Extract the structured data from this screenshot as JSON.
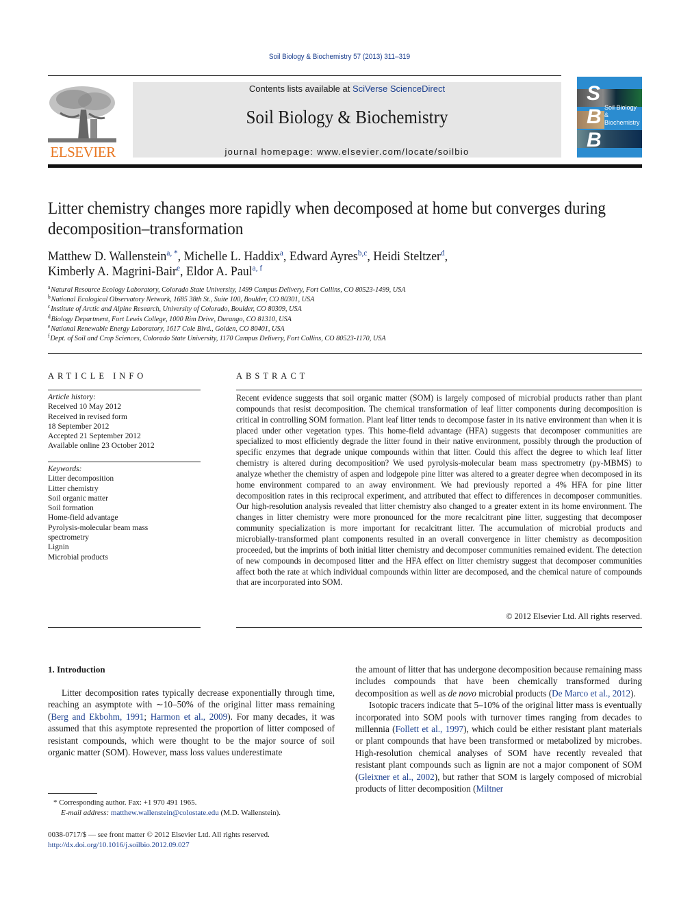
{
  "header": {
    "citation": "Soil Biology & Biochemistry 57 (2013) 311–319",
    "contents_prefix": "Contents lists available at ",
    "contents_link": "SciVerse ScienceDirect",
    "journal_title": "Soil Biology & Biochemistry",
    "homepage": "journal homepage: www.elsevier.com/locate/soilbio",
    "publisher_logo_text": "ELSEVIER",
    "cover": {
      "letters": [
        "S",
        "B",
        "B"
      ],
      "subtitle_line1": "Soil Biology &",
      "subtitle_line2": "Biochemistry"
    },
    "colors": {
      "publisher_orange": "#e87722",
      "cover_blue": "#2b8cd0",
      "link_blue": "#1b3f8f",
      "masthead_gray": "#e6e6e6"
    }
  },
  "article": {
    "title": "Litter chemistry changes more rapidly when decomposed at home but converges during decomposition–transformation",
    "authors": [
      {
        "name": "Matthew D. Wallenstein",
        "affil": "a, *",
        "sep": ", "
      },
      {
        "name": "Michelle L. Haddix",
        "affil": "a",
        "sep": ", "
      },
      {
        "name": "Edward Ayres",
        "affil": "b,c",
        "sep": ", "
      },
      {
        "name": "Heidi Steltzer",
        "affil": "d",
        "sep": ","
      },
      {
        "name": "Kimberly A. Magrini-Bair",
        "affil": "e",
        "sep": ", "
      },
      {
        "name": "Eldor A. Paul",
        "affil": "a, f",
        "sep": ""
      }
    ],
    "affiliations": [
      {
        "key": "a",
        "text": "Natural Resource Ecology Laboratory, Colorado State University, 1499 Campus Delivery, Fort Collins, CO 80523-1499, USA"
      },
      {
        "key": "b",
        "text": "National Ecological Observatory Network, 1685 38th St., Suite 100, Boulder, CO 80301, USA"
      },
      {
        "key": "c",
        "text": "Institute of Arctic and Alpine Research, University of Colorado, Boulder, CO 80309, USA"
      },
      {
        "key": "d",
        "text": "Biology Department, Fort Lewis College, 1000 Rim Drive, Durango, CO 81310, USA"
      },
      {
        "key": "e",
        "text": "National Renewable Energy Laboratory, 1617 Cole Blvd., Golden, CO 80401, USA"
      },
      {
        "key": "f",
        "text": "Dept. of Soil and Crop Sciences, Colorado State University, 1170 Campus Delivery, Fort Collins, CO 80523-1170, USA"
      }
    ]
  },
  "article_info": {
    "heading": "ARTICLE INFO",
    "history_label": "Article history:",
    "history": [
      "Received 10 May 2012",
      "Received in revised form",
      "18 September 2012",
      "Accepted 21 September 2012",
      "Available online 23 October 2012"
    ],
    "keywords_label": "Keywords:",
    "keywords": [
      "Litter decomposition",
      "Litter chemistry",
      "Soil organic matter",
      "Soil formation",
      "Home-field advantage",
      "Pyrolysis-molecular beam mass",
      "spectrometry",
      "Lignin",
      "Microbial products"
    ]
  },
  "abstract": {
    "heading": "ABSTRACT",
    "text": "Recent evidence suggests that soil organic matter (SOM) is largely composed of microbial products rather than plant compounds that resist decomposition. The chemical transformation of leaf litter components during decomposition is critical in controlling SOM formation. Plant leaf litter tends to decompose faster in its native environment than when it is placed under other vegetation types. This home-field advantage (HFA) suggests that decomposer communities are specialized to most efficiently degrade the litter found in their native environment, possibly through the production of specific enzymes that degrade unique compounds within that litter. Could this affect the degree to which leaf litter chemistry is altered during decomposition? We used pyrolysis-molecular beam mass spectrometry (py-MBMS) to analyze whether the chemistry of aspen and lodgepole pine litter was altered to a greater degree when decomposed in its home environment compared to an away environment. We had previously reported a 4% HFA for pine litter decomposition rates in this reciprocal experiment, and attributed that effect to differences in decomposer communities. Our high-resolution analysis revealed that litter chemistry also changed to a greater extent in its home environment. The changes in litter chemistry were more pronounced for the more recalcitrant pine litter, suggesting that decomposer community specialization is more important for recalcitrant litter. The accumulation of microbial products and microbially-transformed plant components resulted in an overall convergence in litter chemistry as decomposition proceeded, but the imprints of both initial litter chemistry and decomposer communities remained evident. The detection of new compounds in decomposed litter and the HFA effect on litter chemistry suggest that decomposer communities affect both the rate at which individual compounds within litter are decomposed, and the chemical nature of compounds that are incorporated into SOM.",
    "copyright": "© 2012 Elsevier Ltd. All rights reserved."
  },
  "introduction": {
    "heading": "1.  Introduction",
    "left": {
      "t1": "Litter decomposition rates typically decrease exponentially through time, reaching an asymptote with ∼10–50% of the original litter mass remaining (",
      "ref1": "Berg and Ekbohm, 1991",
      "t2": "; ",
      "ref2": "Harmon et al., 2009",
      "t3": "). For many decades, it was assumed that this asymptote represented the proportion of litter composed of resistant compounds, which were thought to be the major source of soil organic matter (SOM). However, mass loss values underestimate"
    },
    "right_p1": {
      "t1": "the amount of litter that has undergone decomposition because remaining mass includes compounds that have been chemically transformed during decomposition as well as ",
      "italic": "de novo",
      "t2": " microbial products (",
      "ref1": "De Marco et al., 2012",
      "t3": ")."
    },
    "right_p2": {
      "t1": "Isotopic tracers indicate that 5–10% of the original litter mass is eventually incorporated into SOM pools with turnover times ranging from decades to millennia (",
      "ref1": "Follett et al., 1997",
      "t2": "), which could be either resistant plant materials or plant compounds that have been transformed or metabolized by microbes. High-resolution chemical analyses of SOM have recently revealed that resistant plant compounds such as lignin are not a major component of SOM (",
      "ref2": "Gleixner et al., 2002",
      "t3": "), but rather that SOM is largely composed of microbial products of litter decomposition (",
      "ref3": "Miltner"
    }
  },
  "footnotes": {
    "corresponding": "*  Corresponding author. Fax: +1 970 491 1965.",
    "email_label": "E-mail address:",
    "email": "matthew.wallenstein@colostate.edu",
    "email_suffix": " (M.D. Wallenstein).",
    "front_matter": "0038-0717/$ — see front matter © 2012 Elsevier Ltd. All rights reserved.",
    "doi": "http://dx.doi.org/10.1016/j.soilbio.2012.09.027"
  }
}
